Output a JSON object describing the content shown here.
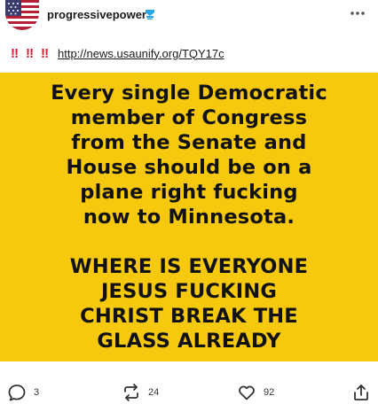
{
  "post": {
    "username": "progressivepower",
    "badge_icon": "blue-badge-icon",
    "more_icon": "more-options-icon",
    "caption": {
      "prefix_emoji": [
        "‼",
        "‼",
        "‼"
      ],
      "link_text": "http://news.usaunify.org/TQY17c"
    },
    "image_text": {
      "paragraph1": [
        "Every single Democratic",
        "member of Congress",
        "from the Senate and",
        "House should be on a",
        "plane right fucking",
        "now to Minnesota."
      ],
      "paragraph2": [
        "WHERE IS EVERYONE",
        "JESUS FUCKING",
        "CHRIST BREAK THE",
        "GLASS ALREADY"
      ],
      "background_color": "#f6c90e"
    },
    "actions": {
      "reply_count": "3",
      "reblog_count": "24",
      "like_count": "92"
    }
  }
}
